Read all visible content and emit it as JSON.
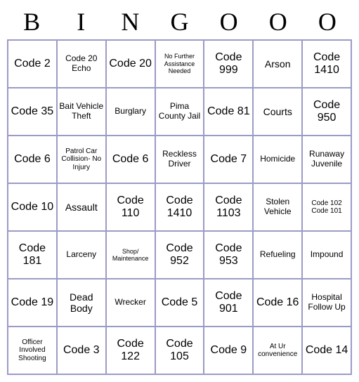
{
  "header": [
    "B",
    "I",
    "N",
    "G",
    "O",
    "O",
    "O"
  ],
  "cells": [
    [
      {
        "text": "Code 2",
        "size": "large"
      },
      {
        "text": "Code 20 Echo",
        "size": "medium"
      },
      {
        "text": "Code 20",
        "size": "large"
      },
      {
        "text": "No Further Assistance Needed",
        "size": "xsmall"
      },
      {
        "text": "Code 999",
        "size": "large"
      },
      {
        "text": "Arson",
        "size": ""
      },
      {
        "text": "Code 1410",
        "size": "large"
      }
    ],
    [
      {
        "text": "Code 35",
        "size": "large"
      },
      {
        "text": "Bait Vehicle Theft",
        "size": "medium"
      },
      {
        "text": "Burglary",
        "size": "medium"
      },
      {
        "text": "Pima County Jail",
        "size": "medium"
      },
      {
        "text": "Code 81",
        "size": "large"
      },
      {
        "text": "Courts",
        "size": ""
      },
      {
        "text": "Code 950",
        "size": "large"
      }
    ],
    [
      {
        "text": "Code 6",
        "size": "large"
      },
      {
        "text": "Patrol Car Collision- No Injury",
        "size": "small"
      },
      {
        "text": "Code 6",
        "size": "large"
      },
      {
        "text": "Reckless Driver",
        "size": "medium"
      },
      {
        "text": "Code 7",
        "size": "large"
      },
      {
        "text": "Homicide",
        "size": "medium"
      },
      {
        "text": "Runaway Juvenile",
        "size": "medium"
      }
    ],
    [
      {
        "text": "Code 10",
        "size": "large"
      },
      {
        "text": "Assault",
        "size": ""
      },
      {
        "text": "Code 110",
        "size": "large"
      },
      {
        "text": "Code 1410",
        "size": "large"
      },
      {
        "text": "Code 1103",
        "size": "large"
      },
      {
        "text": "Stolen Vehicle",
        "size": "medium"
      },
      {
        "text": "Code 102 Code 101",
        "size": "small"
      }
    ],
    [
      {
        "text": "Code 181",
        "size": "large"
      },
      {
        "text": "Larceny",
        "size": "medium"
      },
      {
        "text": "Shop/ Maintenance",
        "size": "xsmall"
      },
      {
        "text": "Code 952",
        "size": "large"
      },
      {
        "text": "Code 953",
        "size": "large"
      },
      {
        "text": "Refueling",
        "size": "medium"
      },
      {
        "text": "Impound",
        "size": "medium"
      }
    ],
    [
      {
        "text": "Code 19",
        "size": "large"
      },
      {
        "text": "Dead Body",
        "size": ""
      },
      {
        "text": "Wrecker",
        "size": "medium"
      },
      {
        "text": "Code 5",
        "size": "large"
      },
      {
        "text": "Code 901",
        "size": "large"
      },
      {
        "text": "Code 16",
        "size": "large"
      },
      {
        "text": "Hospital Follow Up",
        "size": "medium"
      }
    ],
    [
      {
        "text": "Officer Involved Shooting",
        "size": "small"
      },
      {
        "text": "Code 3",
        "size": "large"
      },
      {
        "text": "Code 122",
        "size": "large"
      },
      {
        "text": "Code 105",
        "size": "large"
      },
      {
        "text": "Code 9",
        "size": "large"
      },
      {
        "text": "At Ur convenience",
        "size": "small"
      },
      {
        "text": "Code 14",
        "size": "large"
      }
    ]
  ]
}
